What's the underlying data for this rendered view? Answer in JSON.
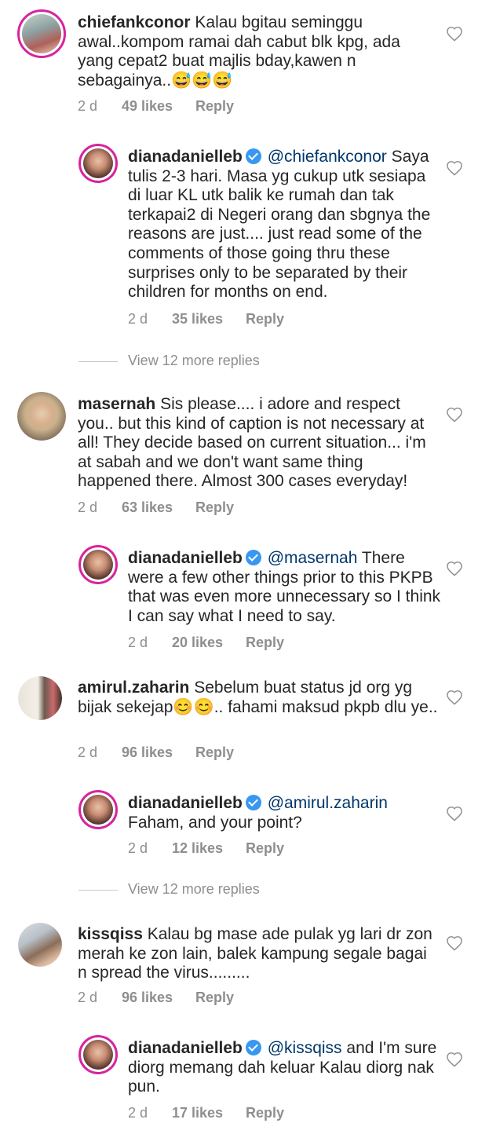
{
  "comments": [
    {
      "username": "chiefankconor",
      "text": "Kalau bgitau seminggu awal..kompom ramai dah cabut blk kpg, ada yang cepat2 buat majlis bday,kawen n sebagainya..😅😅😅",
      "time": "2 d",
      "likes": "49 likes",
      "reply_label": "Reply"
    },
    {
      "username": "dianadanielleb",
      "mention": "@chiefankconor",
      "text": "Saya tulis 2-3 hari. Masa yg cukup utk sesiapa di luar KL utk balik ke rumah dan tak terkapai2 di Negeri orang dan sbgnya the reasons are just.... just read some of the comments of those going thru these surprises only to be separated by their children for months on end.",
      "time": "2 d",
      "likes": "35 likes",
      "reply_label": "Reply"
    },
    {
      "username": "masernah",
      "text": "Sis please.... i adore and respect you.. but this kind of caption is not necessary at all! They decide based on current situation... i'm at sabah and we don't want same thing happened there. Almost 300 cases everyday!",
      "time": "2 d",
      "likes": "63 likes",
      "reply_label": "Reply"
    },
    {
      "username": "dianadanielleb",
      "mention": "@masernah",
      "text": "There were a few other things prior to this PKPB that was even more unnecessary so I think I can say what I need to say.",
      "time": "2 d",
      "likes": "20 likes",
      "reply_label": "Reply"
    },
    {
      "username": "amirul.zaharin",
      "text": "Sebelum buat status jd org yg bijak sekejap😊😊.. fahami maksud pkpb dlu ye..",
      "time": "2 d",
      "likes": "96 likes",
      "reply_label": "Reply"
    },
    {
      "username": "dianadanielleb",
      "mention": "@amirul.zaharin",
      "text": "Faham, and your point?",
      "time": "2 d",
      "likes": "12 likes",
      "reply_label": "Reply"
    },
    {
      "username": "kissqiss",
      "text": "Kalau bg mase ade pulak yg lari dr zon merah ke zon lain, balek kampung segale bagai n spread the virus.........",
      "time": "2 d",
      "likes": "96 likes",
      "reply_label": "Reply"
    },
    {
      "username": "dianadanielleb",
      "mention": "@kissqiss",
      "text": "and I'm sure diorg memang dah keluar Kalau diorg nak pun.",
      "time": "2 d",
      "likes": "17 likes",
      "reply_label": "Reply"
    }
  ],
  "view_more": [
    "View 12 more replies",
    "View 12 more replies"
  ],
  "colors": {
    "text": "#262626",
    "secondary": "#8e8e8e",
    "mention": "#00376b",
    "verified": "#3897f0",
    "story_ring": "#d6249f"
  },
  "icons": {
    "like": "heart-outline-icon",
    "verified": "verified-badge-icon"
  }
}
